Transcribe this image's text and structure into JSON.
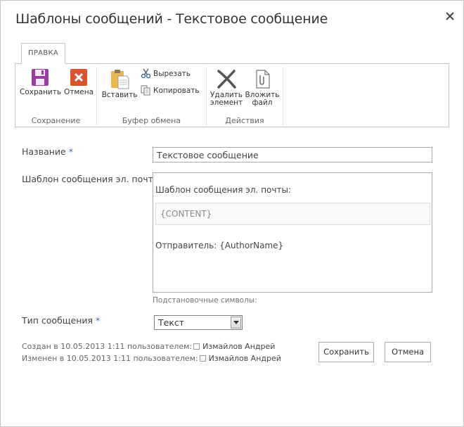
{
  "dialog": {
    "title": "Шаблоны сообщений - Текстовое сообщение"
  },
  "ribbon": {
    "tab_label": "ПРАВКА",
    "groups": {
      "save": {
        "label": "Сохранение",
        "save_label": "Сохранить",
        "cancel_label": "Отмена"
      },
      "clipboard": {
        "label": "Буфер обмена",
        "paste_label": "Вставить",
        "cut_label": "Вырезать",
        "copy_label": "Копировать"
      },
      "actions": {
        "label": "Действия",
        "delete_line1": "Удалить",
        "delete_line2": "элемент",
        "attach_line1": "Вложить",
        "attach_line2": "файл"
      }
    }
  },
  "form": {
    "name_label": "Название",
    "required_mark": "*",
    "name_value": "Текстовое сообщение",
    "template_label": "Шаблон сообщения эл. почты",
    "template_title": "Шаблон сообщения эл. почты:",
    "template_content": "{CONTENT}",
    "template_sender": "Отправитель:  {AuthorName}",
    "placeholders_hint": "Подстановочные символы:",
    "type_label": "Тип сообщения",
    "type_value": "Текст"
  },
  "meta": {
    "created_prefix": "Создан в 10.05.2013 1:11  пользователем:",
    "created_user": "Измайлов Андрей",
    "modified_prefix": "Изменен в 10.05.2013 1:11  пользователем:",
    "modified_user": "Измайлов Андрей"
  },
  "buttons": {
    "save": "Сохранить",
    "cancel": "Отмена"
  },
  "colors": {
    "save_icon": "#9b3ea3",
    "cancel_icon": "#d9532c",
    "required": "#2b6fb6"
  }
}
